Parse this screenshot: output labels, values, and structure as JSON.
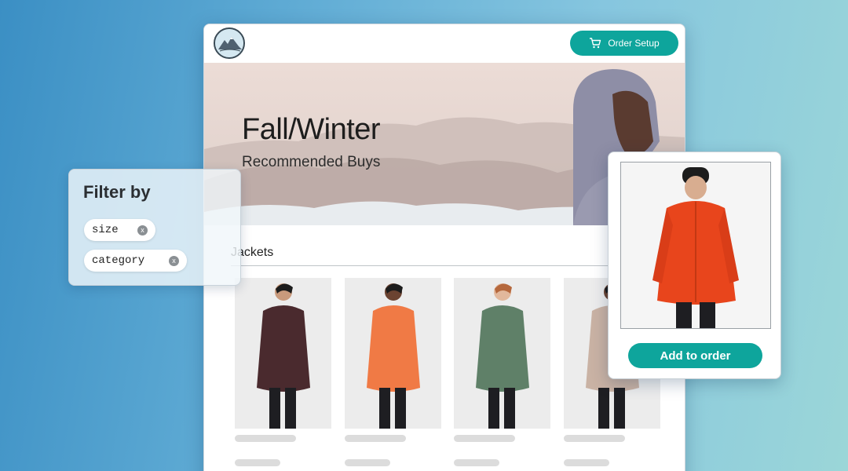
{
  "header": {
    "order_button_label": "Order Setup",
    "cart_icon": "cart-icon",
    "logo": "mountain-logo"
  },
  "hero": {
    "title": "Fall/Winter",
    "subtitle": "Recommended Buys"
  },
  "section": {
    "title": "Jackets"
  },
  "products": [
    {
      "jacket_color": "#4a2a2e"
    },
    {
      "jacket_color": "#f07a45"
    },
    {
      "jacket_color": "#5f8068"
    },
    {
      "jacket_color": "#c9b2a4"
    }
  ],
  "filter": {
    "title": "Filter by",
    "chips": [
      {
        "label": "size",
        "remove_icon": "close-icon"
      },
      {
        "label": "category",
        "remove_icon": "close-icon"
      }
    ]
  },
  "product_popup": {
    "jacket_color": "#e8451c",
    "add_button_label": "Add to order"
  },
  "colors": {
    "accent": "#0ea59c",
    "background_start": "#3b8fc4",
    "background_end": "#9bd6d8"
  }
}
